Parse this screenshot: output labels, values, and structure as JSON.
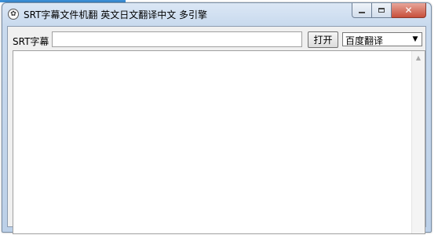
{
  "window": {
    "title": "SRT字幕文件机翻 英文日文翻译中文 多引擎",
    "app_icon": "app-icon",
    "buttons": {
      "minimize_icon": "minimize-icon",
      "maximize_icon": "maximize-icon",
      "close_icon": "close-icon",
      "close_glyph": "✕"
    }
  },
  "toolbar": {
    "file_label": "SRT字幕",
    "file_input_value": "",
    "open_label": "打开",
    "engine_selected": "百度翻译",
    "engine_dropdown_glyph": "▼"
  },
  "output": {
    "text": "",
    "scroll_up_glyph": "▲"
  },
  "colors": {
    "title_bar": "#c9daee",
    "close_button": "#c7503c",
    "client_bg": "#f0f0f0"
  }
}
